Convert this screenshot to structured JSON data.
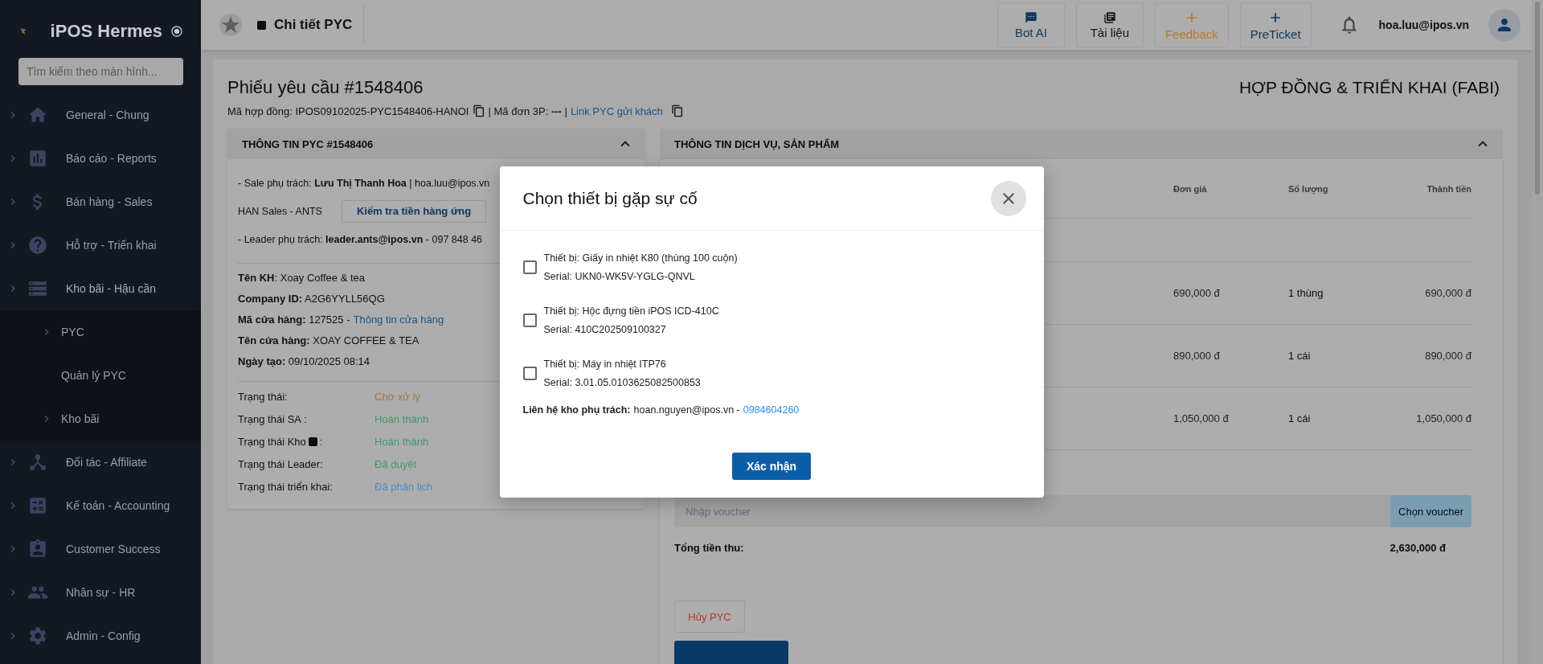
{
  "sidebar": {
    "brand": "iPOS Hermes",
    "search": {
      "placeholder": "Tìm kiếm theo màn hình..."
    },
    "items": [
      {
        "label": "General - Chung",
        "expandable": true
      },
      {
        "label": "Báo cáo - Reports",
        "expandable": true
      },
      {
        "label": "Bán hàng - Sales",
        "expandable": true
      },
      {
        "label": "Hỗ trợ - Triển khai",
        "expandable": true
      },
      {
        "label": "Kho bãi - Hậu cần",
        "expandable": true,
        "expanded": true,
        "children": [
          {
            "label": "PYC",
            "expandable": true
          },
          {
            "label": "Quản lý PYC",
            "expandable": false
          },
          {
            "label": "Kho bãi",
            "expandable": true
          }
        ]
      },
      {
        "label": "Đối tác - Affiliate",
        "expandable": true
      },
      {
        "label": "Kế toán - Accounting",
        "expandable": true
      },
      {
        "label": "Customer Success",
        "expandable": true
      },
      {
        "label": "Nhân sự - HR",
        "expandable": true
      },
      {
        "label": "Admin - Config",
        "expandable": true
      }
    ]
  },
  "header": {
    "breadcrumb": "Chi tiết PYC",
    "tools": [
      {
        "label": "Bot AI",
        "color": "#123761"
      },
      {
        "label": "Tài liệu",
        "color": "#171717"
      },
      {
        "label": "Feedback",
        "color": "#b87a2e"
      },
      {
        "label": "PreTicket",
        "color": "#123761"
      }
    ],
    "user": "hoa.luu@ipos.vn"
  },
  "page": {
    "title": "Phiếu yêu cầu #1548406",
    "section": "HỢP ĐỒNG & TRIỂN KHAI (FABI)",
    "contract": "Mã hợp đồng: IPOS09102025-PYC1548406-HANOI",
    "order_3p": "| Mã đơn 3P: **---** |",
    "link": "Link PYC gửi khách"
  },
  "info_card": {
    "title": "THÔNG TIN PYC #1548406",
    "sale": "- Sale phụ trách: **Lưu Thị Thanh Hoa** | hoa.luu@ipos.vn",
    "team": "HAN Sales - ANTS",
    "check_button": "Kiểm tra tiền hàng ứng",
    "leader": "- Leader phụ trách: **leader.ants@ipos.vn** - 097 848 46",
    "fields": [
      {
        "text": "**Tên KH**: Xoay Coffee & tea"
      },
      {
        "text": "**Company ID:** A2G6YYLL56QG"
      },
      {
        "text": "**Mã cửa hàng:** 127525 -",
        "link": "Thông tin cửa hàng"
      },
      {
        "text": "**Tên cửa hàng:** XOAY COFFEE & TEA"
      },
      {
        "text": "**Ngày tạo:** 09/10/2025 08:14"
      }
    ],
    "statuses": [
      {
        "label": "Trạng thái:",
        "info": false,
        "value": "Chờ xử lý",
        "color": "#a5774a"
      },
      {
        "label": "Trạng thái SA :",
        "info": false,
        "value": "Hoàn thành",
        "color": "#3d9a66"
      },
      {
        "label": "Trạng thái Kho",
        "info": true,
        "suffix": ":",
        "value": "Hoàn thành",
        "color": "#3d9a66"
      },
      {
        "label": "Trạng thái Leader:",
        "info": false,
        "value": "Đã duyệt",
        "color": "#3d9a66"
      },
      {
        "label": "Trạng thái triển khai:",
        "info": false,
        "value": "Đã phân lịch",
        "color": "#4a8cc4"
      }
    ]
  },
  "service_card": {
    "title": "THÔNG TIN DỊCH VỤ, SẢN PHẨM",
    "columns": [
      "Đơn giá",
      "Số lượng",
      "Thành tiền"
    ],
    "rows": [
      {
        "unit_price": "690,000 đ",
        "quantity": "1 thùng",
        "total": "690,000 đ"
      },
      {
        "unit_price": "890,000 đ",
        "quantity": "1 cái",
        "total": "890,000 đ"
      },
      {
        "unit_price": "1,050,000 đ",
        "quantity": "1 cái",
        "total": "1,050,000 đ"
      }
    ],
    "voucher": {
      "placeholder": "Nhập voucher",
      "button": "Chọn voucher"
    },
    "total_label": "Tổng tiền thu:",
    "total": "2,630,000 đ",
    "cancel": "Hủy PYC"
  },
  "modal": {
    "title": "Chọn thiết bị gặp sự cố",
    "devices": [
      {
        "name": "Thiết bị: Giấy in nhiệt K80 (thùng 100 cuộn)",
        "serial": "Serial: UKN0-WK5V-YGLG-QNVL",
        "checked": false
      },
      {
        "name": "Thiết bị: Hộc đựng tiền iPOS ICD-410C",
        "serial": "Serial: 410C202509100327",
        "checked": false
      },
      {
        "name": "Thiết bị: Máy in nhiệt ITP76",
        "serial": "Serial: 3.01.05.0103625082500853",
        "checked": false
      }
    ],
    "contact": {
      "label": "Liên hệ kho phụ trách:",
      "email": "hoan.nguyen@ipos.vn -",
      "phone": "0984604260"
    },
    "confirm": "Xác nhận"
  }
}
